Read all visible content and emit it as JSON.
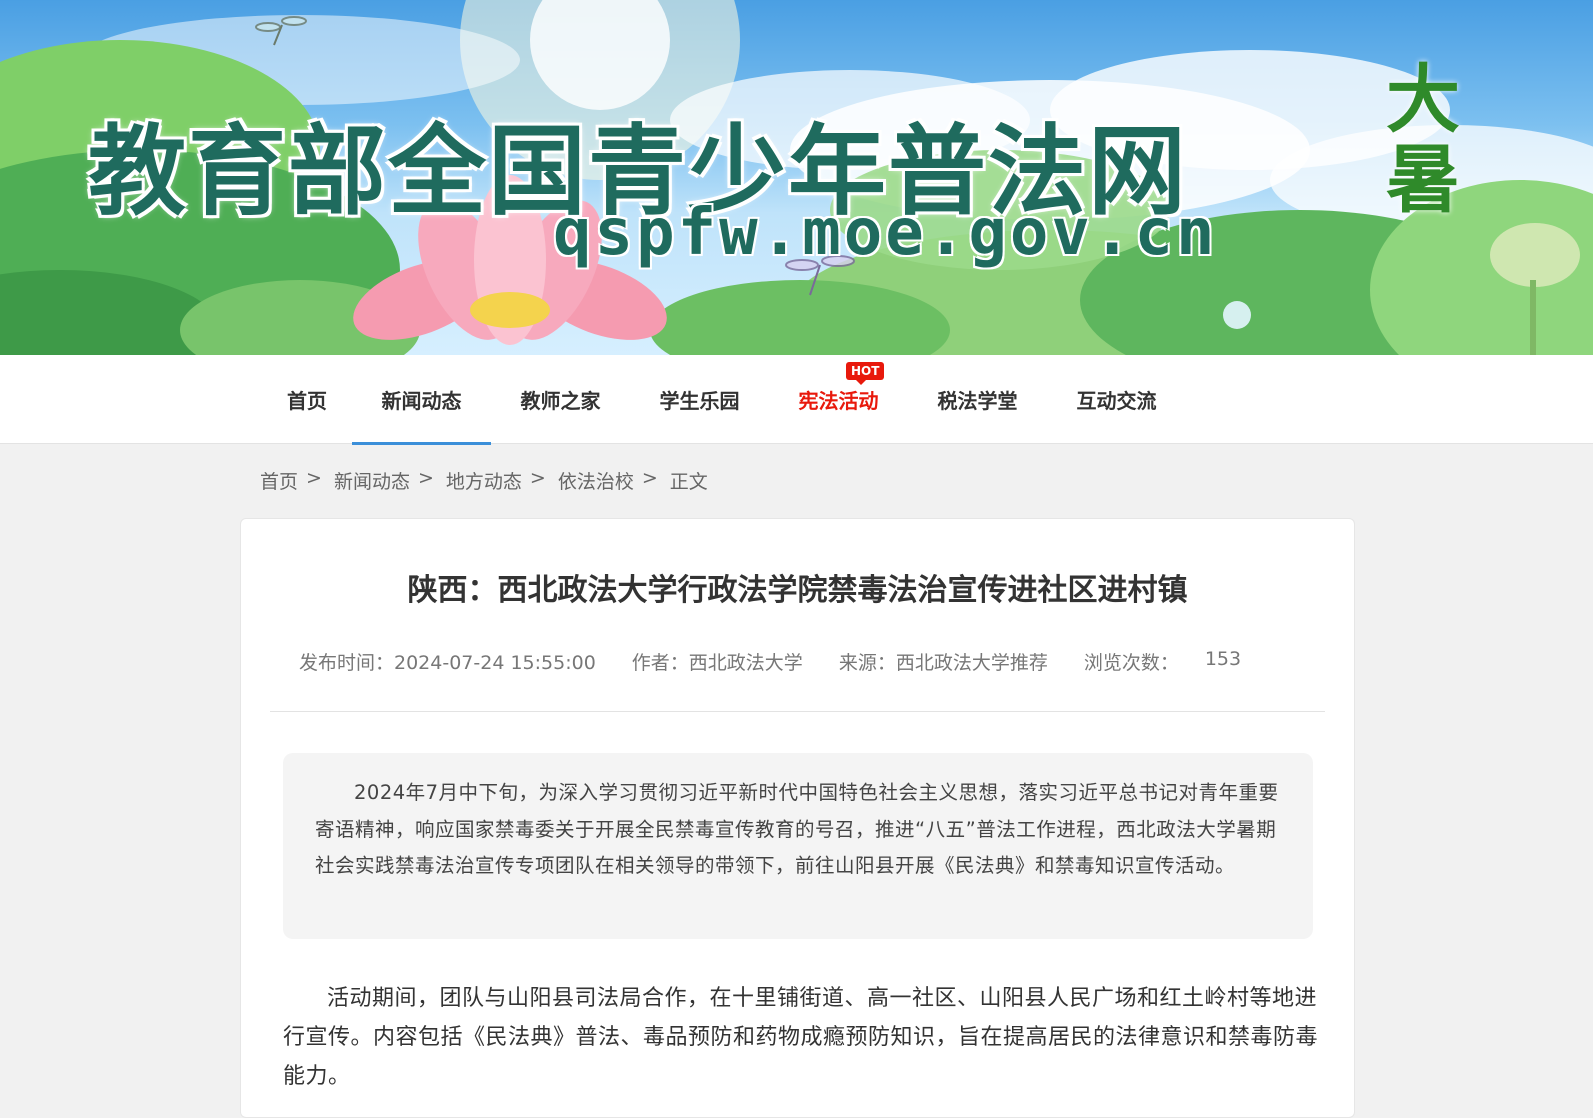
{
  "banner": {
    "title": "教育部全国青少年普法网",
    "url": "qspfw.moe.gov.cn",
    "solar_term": "大暑"
  },
  "nav": {
    "items": [
      {
        "label": "首页"
      },
      {
        "label": "新闻动态"
      },
      {
        "label": "教师之家"
      },
      {
        "label": "学生乐园"
      },
      {
        "label": "宪法活动"
      },
      {
        "label": "税法学堂"
      },
      {
        "label": "互动交流"
      }
    ],
    "active_index": 1,
    "hot_badge": "HOT",
    "hot_color": "#e8190c",
    "active_color": "#3b8fd9"
  },
  "breadcrumb": {
    "items": [
      "首页",
      "新闻动态",
      "地方动态",
      "依法治校"
    ],
    "separator": ">",
    "current": "正文"
  },
  "article": {
    "title": "陕西：西北政法大学行政法学院禁毒法治宣传进社区进村镇",
    "publish_time": "发布时间：2024-07-24 15:55:00",
    "author": "作者：西北政法大学",
    "source": "来源：西北政法大学推荐",
    "views_label": "浏览次数：",
    "views_value": "153",
    "summary": "2024年7月中下旬，为深入学习贯彻习近平新时代中国特色社会主义思想，落实习近平总书记对青年重要寄语精神，响应国家禁毒委关于开展全民禁毒宣传教育的号召，推进“八五”普法工作进程，西北政法大学暑期社会实践禁毒法治宣传专项团队在相关领导的带领下，前往山阳县开展《民法典》和禁毒知识宣传活动。",
    "paragraph_1": "活动期间，团队与山阳县司法局合作，在十里铺街道、高一社区、山阳县人民广场和红土岭村等地进行宣传。内容包括《民法典》普法、毒品预防和药物成瘾预防知识，旨在提高居民的法律意识和禁毒防毒能力。"
  }
}
